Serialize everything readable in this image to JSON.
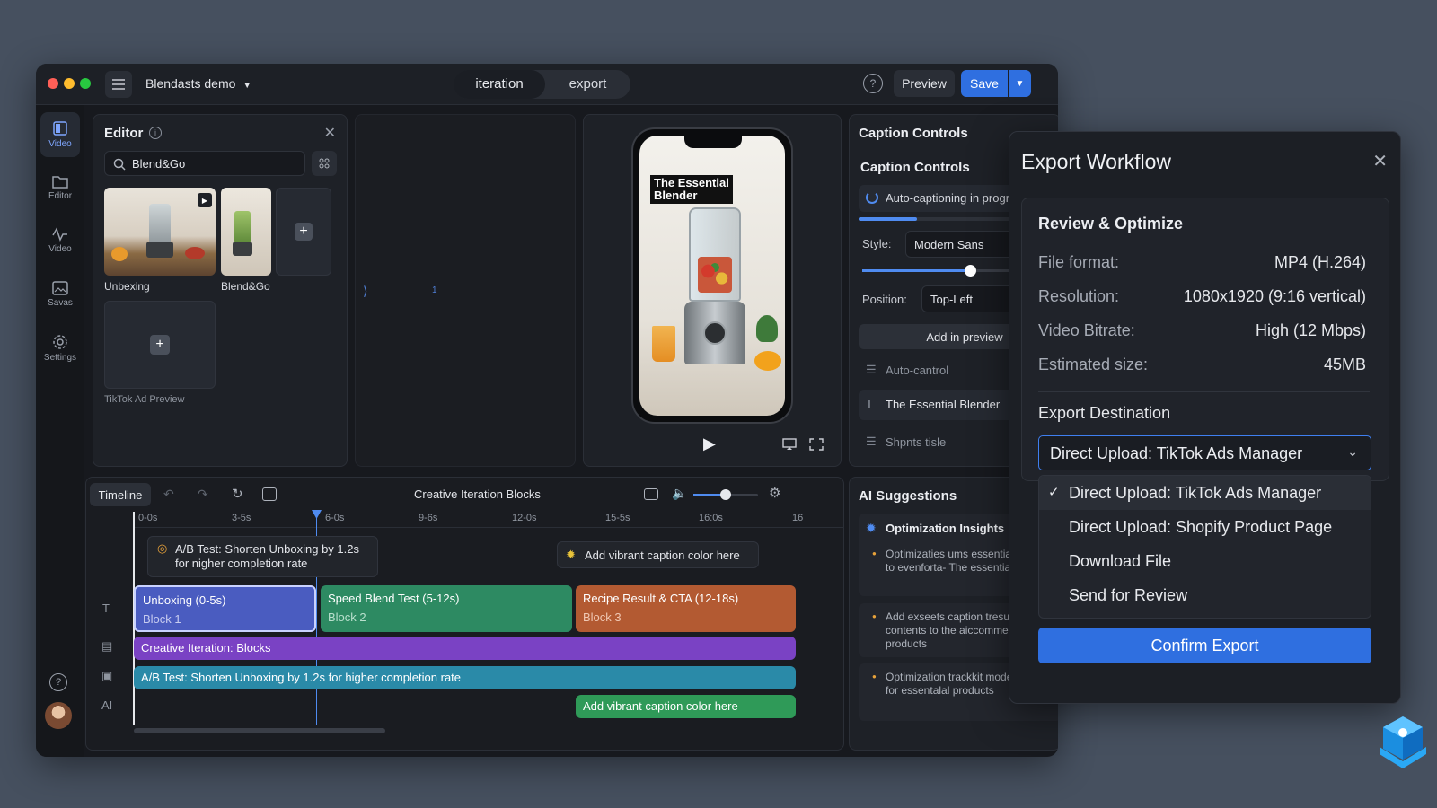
{
  "app": {
    "project_name": "Blendasts demo",
    "modes": [
      "iteration",
      "export"
    ],
    "preview_label": "Preview",
    "save_label": "Save"
  },
  "sidebar": {
    "items": [
      {
        "label": "Video",
        "icon": "video-icon"
      },
      {
        "label": "Editor",
        "icon": "folder-icon"
      },
      {
        "label": "Video",
        "icon": "waveform-icon"
      },
      {
        "label": "Savas",
        "icon": "image-icon"
      },
      {
        "label": "Settings",
        "icon": "gear-icon"
      }
    ]
  },
  "editor": {
    "title": "Editor",
    "search_value": "Blend&Go",
    "assets": [
      {
        "label": "Unbexing"
      },
      {
        "label": "Blend&Go"
      }
    ],
    "preview_tile_label": "TikTok Ad Preview",
    "marker": "1"
  },
  "phone": {
    "overlay_text": "The Essential Blender"
  },
  "caption": {
    "panel_title": "Caption Controls",
    "section_title": "Caption Controls",
    "status": "Auto-captioning in progress",
    "style_label": "Style:",
    "style_value": "Modern Sans",
    "position_label": "Position:",
    "position_value": "Top-Left",
    "add_button": "Add in preview",
    "items": [
      "Auto-cantrol",
      "The Essential Blender",
      "Shpnts tisle"
    ],
    "progress": 0.3,
    "slider": 0.6
  },
  "ai": {
    "title": "AI Suggestions",
    "insights_title": "Optimization Insights",
    "bullets": [
      "Optimizaties ums essential blender to evenforta- The essential product",
      "Add exseets caption tresult contents to the aiccommerc products",
      "Optimization trackkit model tonights for essentalal products"
    ]
  },
  "timeline": {
    "tab": "Timeline",
    "title": "Creative Iteration Blocks",
    "ticks": [
      "0-0s",
      "3-5s",
      "6-0s",
      "9-6s",
      "12-0s",
      "15-5s",
      "16:0s",
      "16"
    ],
    "volume": 0.5,
    "tooltip_ab": "A/B Test: Shorten Unboxing by 1.2s for nigher completion rate",
    "tooltip_caption": "Add vibrant caption color here",
    "blocks": [
      {
        "title": "Unboxing (0-5s)",
        "sub": "Block 1",
        "color": "#4a5cc0"
      },
      {
        "title": "Speed Blend Test (5-12s)",
        "sub": "Block 2",
        "color": "#2d8a62"
      },
      {
        "title": "Recipe Result & CTA (12-18s)",
        "sub": "Block 3",
        "color": "#b35a32"
      }
    ],
    "track_purple": "Creative Iteration: Blocks",
    "track_teal": "A/B Test: Shorten Unboxing by 1.2s for higher completion rate",
    "track_green": "Add vibrant caption color here",
    "track_ai_label": "AI"
  },
  "export": {
    "title": "Export Workflow",
    "section": "Review & Optimize",
    "rows": [
      {
        "label": "File format:",
        "value": "MP4 (H.264)"
      },
      {
        "label": "Resolution:",
        "value": "1080x1920 (9:16 vertical)"
      },
      {
        "label": "Video Bitrate:",
        "value": "High (12 Mbps)"
      },
      {
        "label": "Estimated size:",
        "value": "45MB"
      }
    ],
    "dest_title": "Export Destination",
    "selected": "Direct Upload: TikTok Ads Manager",
    "options": [
      "Direct Upload: TikTok Ads Manager",
      "Direct Upload: Shopify Product Page",
      "Download File",
      "Send for Review"
    ],
    "confirm": "Confirm Export"
  },
  "colors": {
    "accent": "#2f6fe0",
    "purple": "#7a42c4",
    "teal": "#2a8aa8",
    "green": "#2f9a58"
  }
}
